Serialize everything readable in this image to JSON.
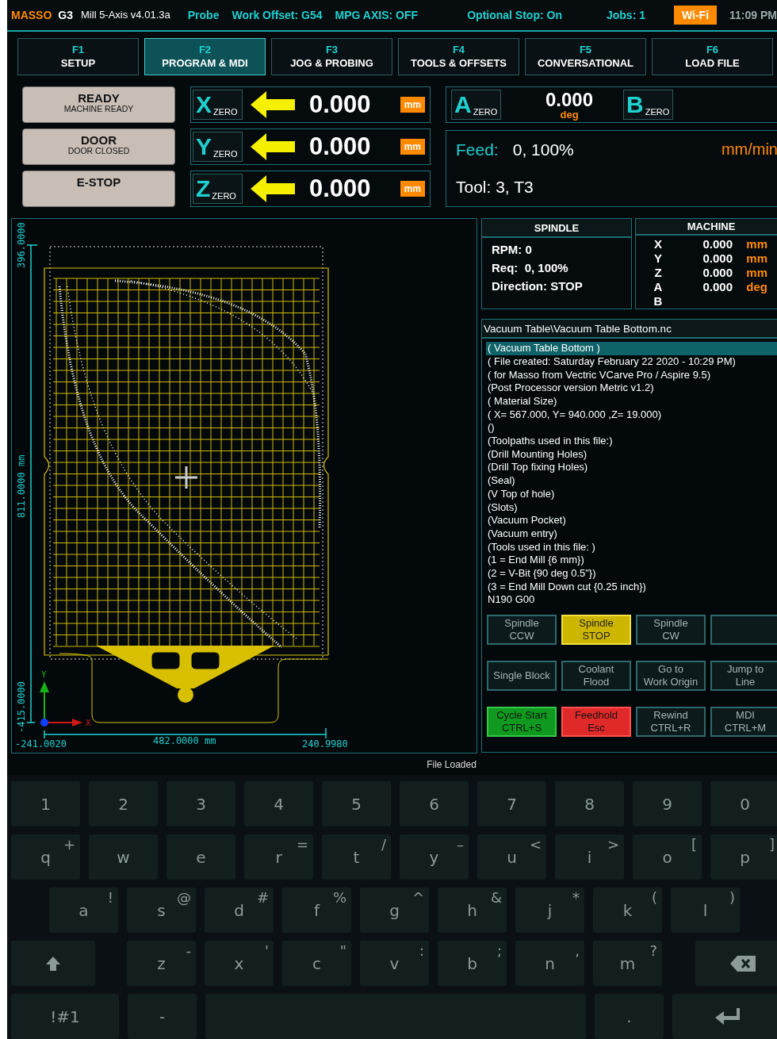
{
  "status_bar": {
    "brand": "MASSO",
    "model": "G3",
    "version": "Mill 5-Axis v4.01.3a",
    "items": [
      "Probe",
      "Work Offset: G54",
      "MPG AXIS: OFF"
    ],
    "right_items": [
      "Optional Stop: On",
      "Jobs: 1"
    ],
    "wifi": "Wi-Fi",
    "time": "11:09 PM"
  },
  "tabs": [
    {
      "key": "F1",
      "label": "SETUP",
      "selected": false
    },
    {
      "key": "F2",
      "label": "PROGRAM & MDI",
      "selected": true
    },
    {
      "key": "F3",
      "label": "JOG & PROBING",
      "selected": false
    },
    {
      "key": "F4",
      "label": "TOOLS & OFFSETS",
      "selected": false
    },
    {
      "key": "F5",
      "label": "CONVERSATIONAL",
      "selected": false
    },
    {
      "key": "F6",
      "label": "LOAD FILE",
      "selected": false
    }
  ],
  "status_buttons": [
    {
      "title": "READY",
      "subtitle": "MACHINE READY"
    },
    {
      "title": "DOOR",
      "subtitle": "DOOR CLOSED"
    },
    {
      "title": "E-STOP"
    }
  ],
  "work_axes": [
    {
      "axis": "X",
      "zero": "ZERO",
      "value": "0.000",
      "unit": "mm"
    },
    {
      "axis": "Y",
      "zero": "ZERO",
      "value": "0.000",
      "unit": "mm"
    },
    {
      "axis": "Z",
      "zero": "ZERO",
      "value": "0.000",
      "unit": "mm"
    }
  ],
  "rotary": {
    "a": {
      "axis": "A",
      "zero": "ZERO"
    },
    "value": "0.000",
    "unit": "deg",
    "b": {
      "axis": "B",
      "zero": "ZERO"
    }
  },
  "feed": {
    "label": "Feed:",
    "value": "0, 100%",
    "unit": "mm/min"
  },
  "tool": "Tool: 3, T3",
  "toolpath": {
    "y_max": "396.0000",
    "height": "811.0000 mm",
    "y_min": "-415.0000",
    "x_min": "-241.0020",
    "width": "482.0000 mm",
    "x_max": "240.9980",
    "y_axis": "Y",
    "x_axis": "X"
  },
  "spindle": {
    "title": "SPINDLE",
    "rpm": "RPM: 0",
    "req": "Req:  0, 100%",
    "direction": "Direction: STOP"
  },
  "machine": {
    "title": "MACHINE",
    "rows": [
      {
        "axis": "X",
        "value": "0.000",
        "unit": "mm"
      },
      {
        "axis": "Y",
        "value": "0.000",
        "unit": "mm"
      },
      {
        "axis": "Z",
        "value": "0.000",
        "unit": "mm"
      },
      {
        "axis": "A",
        "value": "0.000",
        "unit": "deg"
      },
      {
        "axis": "B"
      }
    ]
  },
  "file": {
    "path": "Vacuum Table\\Vacuum Table Bottom.nc",
    "lines": [
      {
        "text": "( Vacuum Table Bottom )",
        "selected": true
      },
      {
        "text": "( File created: Saturday February 22 2020 - 10:29 PM)",
        "selected": false
      },
      {
        "text": "( for Masso from Vectric VCarve Pro / Aspire 9.5)",
        "selected": false
      },
      {
        "text": "(Post Processor version Metric v1.2)",
        "selected": false
      },
      {
        "text": "( Material Size)",
        "selected": false
      },
      {
        "text": "( X= 567.000, Y= 940.000 ,Z= 19.000)",
        "selected": false
      },
      {
        "text": "()",
        "selected": false
      },
      {
        "text": "(Toolpaths used in this file:)",
        "selected": false
      },
      {
        "text": "(Drill Mounting Holes)",
        "selected": false
      },
      {
        "text": "(Drill Top fixing Holes)",
        "selected": false
      },
      {
        "text": "(Seal)",
        "selected": false
      },
      {
        "text": "(V Top of hole)",
        "selected": false
      },
      {
        "text": "(Slots)",
        "selected": false
      },
      {
        "text": "(Vacuum Pocket)",
        "selected": false
      },
      {
        "text": "(Vacuum entry)",
        "selected": false
      },
      {
        "text": "(Tools used in this file: )",
        "selected": false
      },
      {
        "text": "(1 = End Mill {6 mm})",
        "selected": false
      },
      {
        "text": "(2 = V-Bit {90 deg 0.5\"})",
        "selected": false
      },
      {
        "text": "(3 = End Mill Down cut {0.25 inch})",
        "selected": false
      },
      {
        "text": "N190 G00",
        "selected": false
      }
    ]
  },
  "controls": [
    {
      "lines": [
        "Spindle",
        "CCW"
      ],
      "kind": "normal"
    },
    {
      "lines": [
        "Spindle",
        "STOP"
      ],
      "kind": "active"
    },
    {
      "lines": [
        "Spindle",
        "CW"
      ],
      "kind": "normal"
    },
    {
      "kind": "blank"
    },
    {
      "lines": [
        "Single Block"
      ],
      "kind": "normal"
    },
    {
      "lines": [
        "Coolant",
        "Flood"
      ],
      "kind": "normal"
    },
    {
      "lines": [
        "Go to",
        "Work Origin"
      ],
      "kind": "normal"
    },
    {
      "lines": [
        "Jump to",
        "Line"
      ],
      "kind": "normal"
    },
    {
      "lines": [
        "Cycle Start",
        "CTRL+S"
      ],
      "kind": "start"
    },
    {
      "lines": [
        "Feedhold",
        "Esc"
      ],
      "kind": "hold"
    },
    {
      "lines": [
        "Rewind",
        "CTRL+R"
      ],
      "kind": "normal"
    },
    {
      "lines": [
        "MDI",
        "CTRL+M"
      ],
      "kind": "normal"
    }
  ],
  "status_message": "File Loaded",
  "keyboard": {
    "rows": [
      [
        {
          "kind": "char",
          "label": "1"
        },
        {
          "kind": "char",
          "label": "2"
        },
        {
          "kind": "char",
          "label": "3"
        },
        {
          "kind": "char",
          "label": "4"
        },
        {
          "kind": "char",
          "label": "5"
        },
        {
          "kind": "char",
          "label": "6"
        },
        {
          "kind": "char",
          "label": "7"
        },
        {
          "kind": "char",
          "label": "8"
        },
        {
          "kind": "char",
          "label": "9"
        },
        {
          "kind": "char",
          "label": "0"
        }
      ],
      [
        {
          "kind": "char",
          "label": "q",
          "alt": "+"
        },
        {
          "kind": "char",
          "label": "w"
        },
        {
          "kind": "char",
          "label": "e"
        },
        {
          "kind": "char",
          "label": "r",
          "alt": "="
        },
        {
          "kind": "char",
          "label": "t",
          "alt": "/"
        },
        {
          "kind": "char",
          "label": "y",
          "alt": "–"
        },
        {
          "kind": "char",
          "label": "u",
          "alt": "<"
        },
        {
          "kind": "char",
          "label": "i",
          "alt": ">"
        },
        {
          "kind": "char",
          "label": "o",
          "alt": "["
        },
        {
          "kind": "char",
          "label": "p",
          "alt": "]"
        }
      ],
      [
        {
          "kind": "char",
          "label": "a",
          "alt": "!"
        },
        {
          "kind": "char",
          "label": "s",
          "alt": "@"
        },
        {
          "kind": "char",
          "label": "d",
          "alt": "#"
        },
        {
          "kind": "char",
          "label": "f",
          "alt": "%"
        },
        {
          "kind": "char",
          "label": "g",
          "alt": "^"
        },
        {
          "kind": "char",
          "label": "h",
          "alt": "&"
        },
        {
          "kind": "char",
          "label": "j",
          "alt": "*"
        },
        {
          "kind": "char",
          "label": "k",
          "alt": "("
        },
        {
          "kind": "char",
          "label": "l",
          "alt": ")"
        }
      ],
      [
        {
          "kind": "shift"
        },
        {
          "kind": "char",
          "label": "z",
          "alt": "-"
        },
        {
          "kind": "char",
          "label": "x",
          "alt": "'"
        },
        {
          "kind": "char",
          "label": "c",
          "alt": "\""
        },
        {
          "kind": "char",
          "label": "v",
          "alt": ":"
        },
        {
          "kind": "char",
          "label": "b",
          "alt": ";"
        },
        {
          "kind": "char",
          "label": "n",
          "alt": ","
        },
        {
          "kind": "char",
          "label": "m",
          "alt": "?"
        },
        {
          "kind": "backspace"
        }
      ],
      [
        {
          "kind": "mode",
          "label": "!#1"
        },
        {
          "kind": "char",
          "label": "-"
        },
        {
          "kind": "space"
        },
        {
          "kind": "char",
          "label": "."
        },
        {
          "kind": "enter"
        }
      ]
    ]
  }
}
